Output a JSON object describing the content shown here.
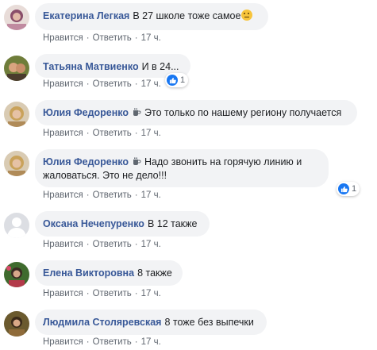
{
  "comments": [
    {
      "author": "Екатерина Легкая",
      "text": "В 27 школе тоже самое",
      "like": "Нравится",
      "reply": "Ответить",
      "time": "17 ч.",
      "emoji": "thinking-emoji"
    },
    {
      "author": "Татьяна Матвиенко",
      "text": "И в 24...",
      "like": "Нравится",
      "reply": "Ответить",
      "time": "17 ч.",
      "reactions": "1"
    },
    {
      "author": "Юлия Федоренко",
      "text": "Это только по нашему региону получается",
      "like": "Нравится",
      "reply": "Ответить",
      "time": "17 ч.",
      "badge": "coffee-cup-icon"
    },
    {
      "author": "Юлия Федоренко",
      "text_line1": "Надо звонить на горячую линию и",
      "text_line2": "жаловаться. Это не дело!!!",
      "like": "Нравится",
      "reply": "Ответить",
      "time": "17 ч.",
      "reactions": "1",
      "badge": "coffee-cup-icon"
    },
    {
      "author": "Оксана Нечепуренко",
      "text": "В 12 также",
      "like": "Нравится",
      "reply": "Ответить",
      "time": "17 ч."
    },
    {
      "author": "Елена Викторовна",
      "text": "8 также",
      "like": "Нравится",
      "reply": "Ответить",
      "time": "17 ч."
    },
    {
      "author": "Людмила Столяревская",
      "text": "8 тоже без выпечки",
      "like": "Нравится",
      "reply": "Ответить",
      "time": "17 ч."
    }
  ],
  "colors": {
    "author": "#385898",
    "bubble": "#f2f3f5",
    "meta": "#606770",
    "like_blue": "#1877f2"
  }
}
